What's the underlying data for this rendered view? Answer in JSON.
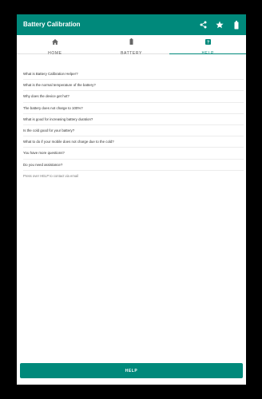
{
  "app": {
    "title": "Battery Calibration",
    "accent_color": "#00897b"
  },
  "toolbar": {
    "actions": [
      {
        "name": "share-icon"
      },
      {
        "name": "star-icon"
      },
      {
        "name": "battery-icon"
      }
    ]
  },
  "tabs": [
    {
      "label": "HOME",
      "icon": "home-icon",
      "active": false
    },
    {
      "label": "BATTERY",
      "icon": "battery-icon",
      "active": false
    },
    {
      "label": "HELP",
      "icon": "help-icon",
      "active": true
    }
  ],
  "faq": {
    "questions": [
      "What is Battery Calibration Helper?",
      "What is the normal temperature of the battery?",
      "Why does the device get hot?",
      "The battery does not charge to 100%?",
      "What is good for increasing battery duration?",
      "Is the cold good for your battery?",
      "What to do if your mobile does not charge due to the cold?",
      "You have more questions?",
      "Do you need assistance?"
    ],
    "footer": "Press over HELP to contact via email"
  },
  "help_button": {
    "label": "HELP"
  }
}
